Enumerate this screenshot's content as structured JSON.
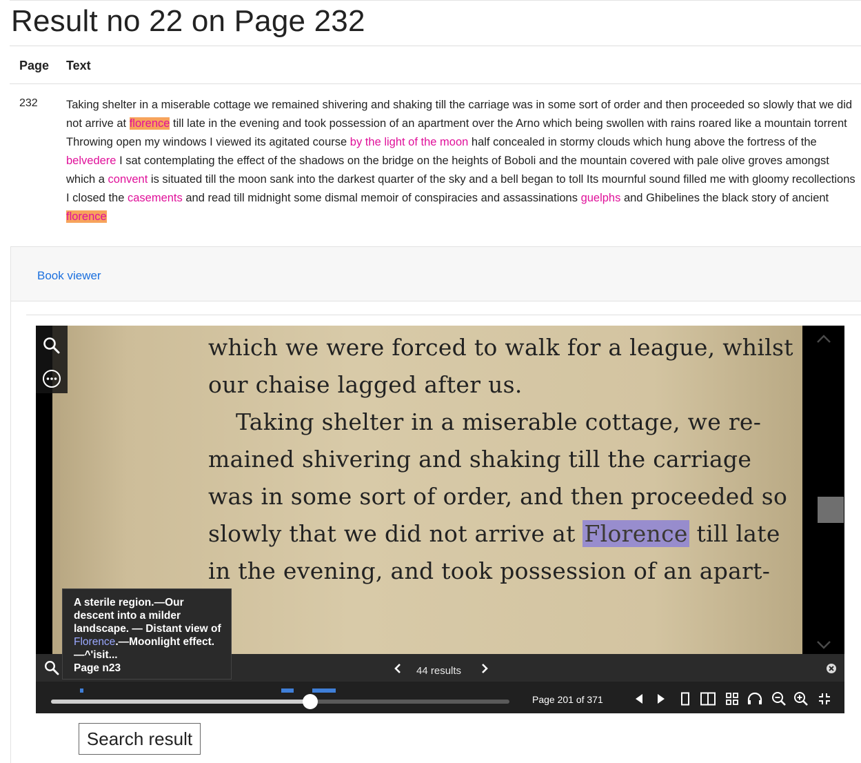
{
  "title": "Result no 22 on Page 232",
  "table": {
    "headers": [
      "Page",
      "Text"
    ],
    "row": {
      "page": "232",
      "text_segments": [
        {
          "t": "Taking shelter in a miserable cottage we remained shivering and shaking till the carriage was in some sort of order and then proceeded so slowly that we did not arrive at ",
          "s": "plain"
        },
        {
          "t": "florence",
          "s": "orange"
        },
        {
          "t": " till late in the evening and took possession of an apartment over the Arno which being swollen with rains roared like a mountain torrent Throwing open my windows I viewed its agitated course ",
          "s": "plain"
        },
        {
          "t": "by the light of the moon",
          "s": "pink"
        },
        {
          "t": " half concealed in stormy clouds which hung above the fortress of the ",
          "s": "plain"
        },
        {
          "t": "belvedere",
          "s": "pink"
        },
        {
          "t": " I sat contemplating the effect of the shadows on the bridge on the heights of Boboli and the mountain covered with pale olive groves amongst which a ",
          "s": "plain"
        },
        {
          "t": "convent",
          "s": "pink"
        },
        {
          "t": " is situated till the moon sank into the darkest quarter of the sky and a bell began to toll Its mournful sound filled me with gloomy recollections I closed the ",
          "s": "plain"
        },
        {
          "t": "casements",
          "s": "pink"
        },
        {
          "t": " and read till midnight some dismal memoir of conspiracies and assassinations ",
          "s": "plain"
        },
        {
          "t": "guelphs",
          "s": "pink"
        },
        {
          "t": " and Ghibelines the black story of ancient ",
          "s": "plain"
        },
        {
          "t": "florence",
          "s": "orange"
        }
      ]
    }
  },
  "card": {
    "link": "Book viewer"
  },
  "viewer": {
    "scan_lines": [
      "which we were forced to walk for a league, whilst",
      "our chaise lagged after us.",
      "Taking shelter in a miserable cottage, we re-",
      "mained shivering and shaking till the carriage",
      "was in some sort of order, and then proceeded so",
      {
        "pre": "slowly that we did not arrive at ",
        "hl": "Florence",
        "post": " till late"
      },
      "in the evening, and took possession of an apart-"
    ],
    "search_results": "44 results",
    "page_indicator": "Page 201 of 371",
    "progress": 0.565,
    "tooltip": {
      "pre": "A sterile region.—Our descent into a milder landscape. — Distant view of ",
      "hl": "Florence",
      "post": ".—Moonlight effect.—^'isit...",
      "page": "Page n23"
    }
  },
  "button": {
    "search_result": "Search result"
  },
  "colors": {
    "highlight_orange": "#f7a35c",
    "highlight_pink": "#e0119a",
    "link_blue": "#1a6fde",
    "scan_highlight": "#8e84d6"
  }
}
